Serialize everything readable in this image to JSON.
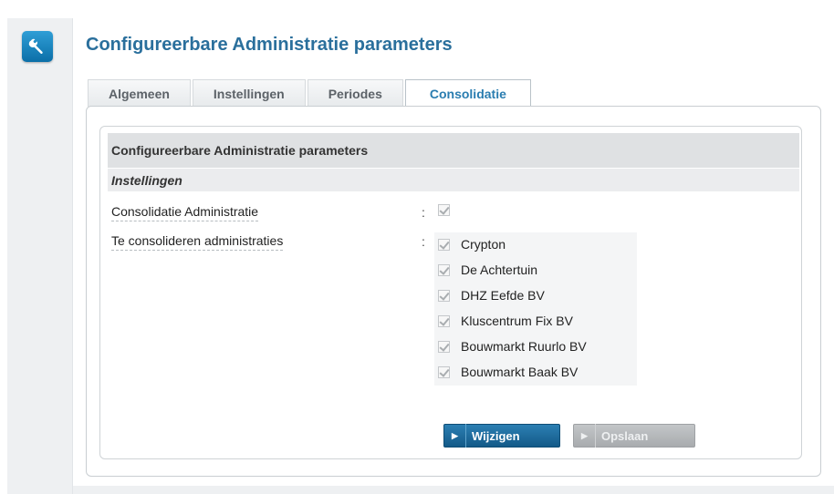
{
  "header": {
    "icon": "wrench-icon",
    "title": "Configureerbare Administratie parameters"
  },
  "tabs": [
    {
      "label": "Algemeen",
      "active": false
    },
    {
      "label": "Instellingen",
      "active": false
    },
    {
      "label": "Periodes",
      "active": false
    },
    {
      "label": "Consolidatie",
      "active": true
    }
  ],
  "panel": {
    "section_title": "Configureerbare Administratie parameters",
    "subsection_title": "Instellingen",
    "fields": {
      "consolidatie": {
        "label": "Consolidatie Administratie",
        "separator": ":",
        "checked": true
      },
      "te_consolideren": {
        "label": "Te consolideren administraties",
        "separator": ":"
      }
    },
    "administraties": [
      {
        "label": "Crypton",
        "checked": true
      },
      {
        "label": "De Achtertuin",
        "checked": true
      },
      {
        "label": "DHZ Eefde BV",
        "checked": true
      },
      {
        "label": "Kluscentrum Fix BV",
        "checked": true
      },
      {
        "label": "Bouwmarkt Ruurlo BV",
        "checked": true
      },
      {
        "label": "Bouwmarkt Baak BV",
        "checked": true
      }
    ]
  },
  "buttons": {
    "wijzigen": "Wijzigen",
    "opslaan": "Opslaan"
  },
  "colors": {
    "accent": "#2a6f9c",
    "primary_button": "#1d6b9c",
    "disabled_button": "#b5b8bb"
  }
}
